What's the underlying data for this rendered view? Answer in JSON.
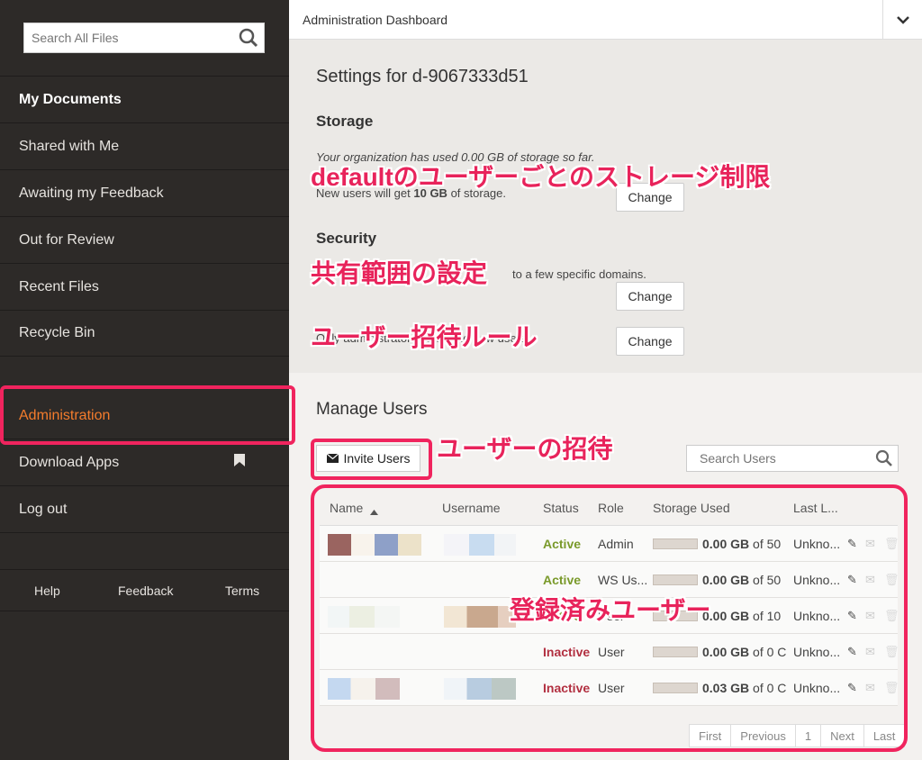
{
  "sidebar": {
    "search_placeholder": "Search All Files",
    "items": [
      {
        "label": "My Documents"
      },
      {
        "label": "Shared with Me"
      },
      {
        "label": "Awaiting my Feedback"
      },
      {
        "label": "Out for Review"
      },
      {
        "label": "Recent Files"
      },
      {
        "label": "Recycle Bin"
      }
    ],
    "items2": [
      {
        "label": "Administration"
      },
      {
        "label": "Download Apps"
      },
      {
        "label": "Log out"
      }
    ],
    "footer": {
      "help": "Help",
      "feedback": "Feedback",
      "terms": "Terms"
    }
  },
  "header": {
    "title": "Administration Dashboard"
  },
  "settings": {
    "title": "Settings for d-9067333d51",
    "storage_heading": "Storage",
    "storage_used_text": "Your organization has used 0.00 GB of storage so far.",
    "new_users_prefix": "New users will get ",
    "new_users_amount": "10 GB",
    "new_users_suffix": " of storage.",
    "security_heading": "Security",
    "sharing_text": "to a few specific domains.",
    "invite_rule_text": "Only administrators can invite new users.",
    "change_label": "Change"
  },
  "manage": {
    "title": "Manage Users",
    "invite_label": "Invite Users",
    "search_placeholder": "Search Users",
    "columns": {
      "name": "Name",
      "username": "Username",
      "status": "Status",
      "role": "Role",
      "storage": "Storage Used",
      "last": "Last L..."
    },
    "rows": [
      {
        "status": "Active",
        "role": "Admin",
        "storage_amount": "0.00 GB",
        "storage_of": "of 50",
        "last": "Unkno..."
      },
      {
        "status": "Active",
        "role": "WS Us...",
        "storage_amount": "0.00 GB",
        "storage_of": "of 50",
        "last": "Unkno..."
      },
      {
        "status": "Active",
        "role": "User",
        "storage_amount": "0.00 GB",
        "storage_of": "of 10",
        "last": "Unkno..."
      },
      {
        "status": "Inactive",
        "role": "User",
        "storage_amount": "0.00 GB",
        "storage_of": "of 0 C",
        "last": "Unkno..."
      },
      {
        "status": "Inactive",
        "role": "User",
        "storage_amount": "0.03 GB",
        "storage_of": "of 0 C",
        "last": "Unkno..."
      }
    ],
    "pager": {
      "first": "First",
      "previous": "Previous",
      "page": "1",
      "next": "Next",
      "last": "Last"
    }
  },
  "annotations": {
    "storage_limit": "defaultのユーザーごとのストレージ制限",
    "sharing_scope": "共有範囲の設定",
    "invite_rule": "ユーザー招待ルール",
    "invite": "ユーザーの招待",
    "registered": "登録済みユーザー"
  },
  "colors": {
    "accent": "#f47c2c",
    "highlight": "#f0245e",
    "active": "#7a9a2b",
    "inactive": "#b23041"
  }
}
